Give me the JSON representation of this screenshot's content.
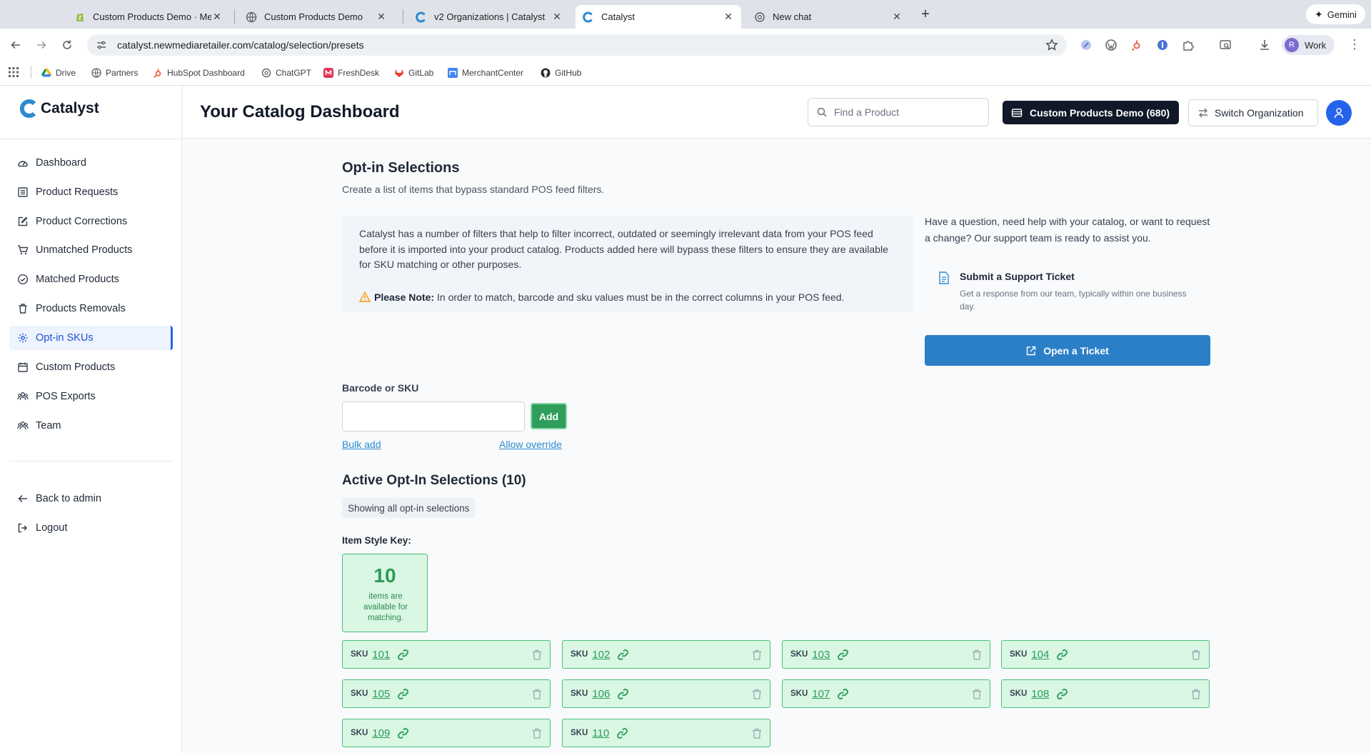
{
  "browser": {
    "tabs": [
      {
        "title": "Custom Products Demo · Me",
        "icon": "shopify-icon",
        "active": false
      },
      {
        "title": "Custom Products Demo",
        "icon": "globe-icon",
        "active": false
      },
      {
        "title": "v2 Organizations | Catalyst",
        "icon": "catalyst-icon",
        "active": false
      },
      {
        "title": "Catalyst",
        "icon": "catalyst-icon",
        "active": true
      },
      {
        "title": "New chat",
        "icon": "chatgpt-icon",
        "active": false
      }
    ],
    "new_tab": "+",
    "gemini_label": "Gemini",
    "url": "catalyst.newmediaretailer.com/catalog/selection/presets",
    "profile_label": "Work",
    "profile_initial": "R",
    "bookmarks": [
      "Drive",
      "Partners",
      "HubSpot Dashboard",
      "ChatGPT",
      "FreshDesk",
      "GitLab",
      "MerchantCenter",
      "GitHub"
    ]
  },
  "app": {
    "brand": "Catalyst",
    "accent_color": "#2563eb",
    "success_color": "#2a9d57",
    "header": {
      "title": "Your Catalog Dashboard",
      "search_placeholder": "Find a Product",
      "org_button": "Custom Products Demo (680)",
      "switch_button": "Switch Organization"
    },
    "sidebar": {
      "items": [
        {
          "label": "Dashboard",
          "icon": "gauge-icon"
        },
        {
          "label": "Product Requests",
          "icon": "list-icon"
        },
        {
          "label": "Product Corrections",
          "icon": "edit-icon"
        },
        {
          "label": "Unmatched Products",
          "icon": "cart-icon"
        },
        {
          "label": "Matched Products",
          "icon": "check-circle-icon"
        },
        {
          "label": "Products Removals",
          "icon": "trash-icon"
        },
        {
          "label": "Opt-in SKUs",
          "icon": "gear-icon",
          "active": true
        },
        {
          "label": "Custom Products",
          "icon": "calendar-icon"
        },
        {
          "label": "POS Exports",
          "icon": "users-icon"
        },
        {
          "label": "Team",
          "icon": "team-icon"
        }
      ],
      "footer": [
        {
          "label": "Back to admin",
          "icon": "arrow-left-icon"
        },
        {
          "label": "Logout",
          "icon": "logout-icon"
        }
      ]
    },
    "section": {
      "title": "Opt-in Selections",
      "subtitle": "Create a list of items that bypass standard POS feed filters.",
      "info": "Catalyst has a number of filters that help to filter incorrect, outdated or seemingly irrelevant data from your POS feed before it is imported into your product catalog. Products added here will bypass these filters to ensure they are available for SKU matching or other purposes.",
      "note_label": "Please Note:",
      "note_text": "In order to match, barcode and sku values must be in the correct columns in your POS feed."
    },
    "support": {
      "text": "Have a question, need help with your catalog, or want to request a change? Our support team is ready to assist you.",
      "ticket_title": "Submit a Support Ticket",
      "ticket_desc": "Get a response from our team, typically within one business day.",
      "button": "Open a Ticket"
    },
    "form": {
      "label": "Barcode or SKU",
      "value": "",
      "add_button": "Add",
      "bulk_add": "Bulk add",
      "allow_override": "Allow override"
    },
    "active": {
      "title": "Active Opt-In Selections (10)",
      "showing": "Showing all opt-in selections",
      "key_label": "Item Style Key:",
      "key_count": "10",
      "key_desc": "items are available for matching.",
      "sku_tag": "SKU",
      "skus": [
        "101",
        "102",
        "103",
        "104",
        "105",
        "106",
        "107",
        "108",
        "109",
        "110"
      ]
    }
  }
}
